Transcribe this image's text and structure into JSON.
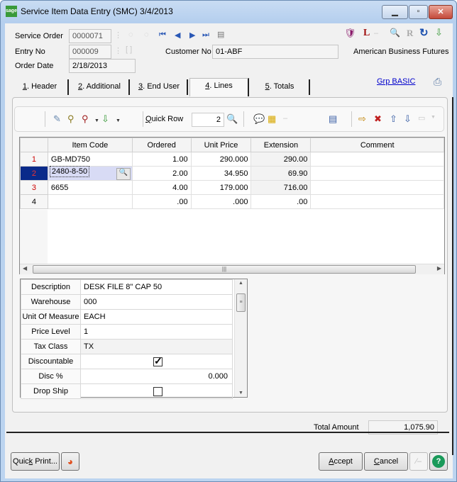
{
  "window": {
    "title": "Service Item Data Entry (SMC) 3/4/2013",
    "logo": "sage",
    "controls": {
      "minimize": "minimize-icon",
      "maximize": "maximize-icon",
      "close": "close-icon"
    }
  },
  "header": {
    "service_order_label": "Service Order",
    "service_order_value": "0000071",
    "entry_no_label": "Entry No",
    "entry_no_value": "000009",
    "order_date_label": "Order Date",
    "order_date_value": "2/18/2013",
    "customer_no_label": "Customer No",
    "customer_no_value": "01-ABF",
    "customer_name": "American Business Futures",
    "nav_icons": [
      "first-record-icon",
      "previous-record-icon",
      "next-record-icon",
      "last-record-icon",
      "notepad-icon"
    ],
    "right_icons": [
      "customer-shield-icon",
      "l-icon",
      "blank-icon",
      "inquiry-icon",
      "r-icon",
      "refresh-icon",
      "import-icon"
    ]
  },
  "tabs": [
    {
      "key": "1",
      "label": ". Header",
      "active": false
    },
    {
      "key": "2",
      "label": ". Additional",
      "active": false
    },
    {
      "key": "3",
      "label": ". End User",
      "active": false
    },
    {
      "key": "4",
      "label": ". Lines",
      "active": true
    },
    {
      "key": "5",
      "label": ". Totals",
      "active": false
    }
  ],
  "grp_link": "Grp BASIC",
  "toolbar": {
    "quick_row_label_key": "Q",
    "quick_row_label_rest": "uick Row",
    "quick_row_value": "2"
  },
  "grid": {
    "columns": [
      "",
      "Item Code",
      "Ordered",
      "Unit Price",
      "Extension",
      "Comment"
    ],
    "rows": [
      {
        "num": "1",
        "item_code": "GB-MD750",
        "ordered": "1.00",
        "unit_price": "290.000",
        "extension": "290.00",
        "comment": ""
      },
      {
        "num": "2",
        "item_code": "2480-8-50",
        "ordered": "2.00",
        "unit_price": "34.950",
        "extension": "69.90",
        "comment": ""
      },
      {
        "num": "3",
        "item_code": "6655",
        "ordered": "4.00",
        "unit_price": "179.000",
        "extension": "716.00",
        "comment": ""
      },
      {
        "num": "4",
        "item_code": "",
        "ordered": ".00",
        "unit_price": ".000",
        "extension": ".00",
        "comment": ""
      }
    ],
    "selected_row": 2
  },
  "properties": [
    {
      "key": "Description",
      "value": "DESK FILE 8\" CAP 50"
    },
    {
      "key": "Warehouse",
      "value": "000"
    },
    {
      "key": "Unit Of Measure",
      "value": "EACH"
    },
    {
      "key": "Price Level",
      "value": "1"
    },
    {
      "key": "Tax Class",
      "value": "TX"
    },
    {
      "key": "Discountable",
      "value": "checked"
    },
    {
      "key": "Disc %",
      "value": "0.000"
    },
    {
      "key": "Drop Ship",
      "value": "unchecked"
    }
  ],
  "totals": {
    "label": "Total Amount",
    "value": "1,075.90"
  },
  "footer": {
    "quick_print_pre": "Quic",
    "quick_print_key": "k",
    "quick_print_post": " Print...",
    "accept_key": "A",
    "accept_rest": "ccept",
    "cancel_key": "C",
    "cancel_rest": "ancel"
  }
}
